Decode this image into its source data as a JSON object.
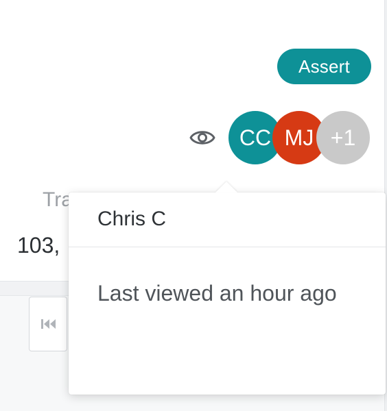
{
  "header": {
    "badge_label": "Assert",
    "viewers": {
      "eye_icon": "eye-icon",
      "avatars": [
        {
          "initials": "CC",
          "color": "#0e9197"
        },
        {
          "initials": "MJ",
          "color": "#d63a14"
        },
        {
          "initials": "+1",
          "color": "#c9c9c9"
        }
      ]
    }
  },
  "background": {
    "metric_label": "Tra",
    "metric_value": "103,",
    "skip_back_icon": "skip-to-start-icon"
  },
  "popover": {
    "title": "Chris C",
    "body": "Last viewed an hour ago"
  },
  "colors": {
    "accent": "#0e9197",
    "avatar_mj": "#d63a14",
    "avatar_more": "#c9c9c9"
  }
}
